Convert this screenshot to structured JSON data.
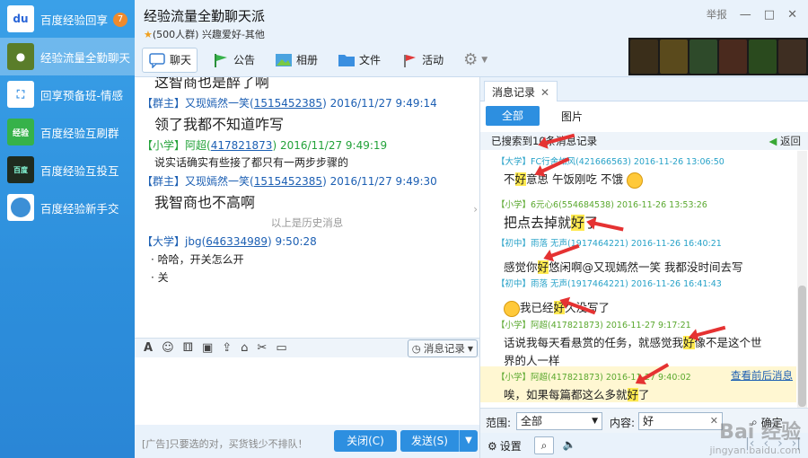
{
  "sidebar": {
    "items": [
      {
        "name": "百度经验回享",
        "badge": "7",
        "icon": "baidu-logo",
        "color": "#ffffff"
      },
      {
        "name": "经验流量全勤聊天",
        "icon": "group-avatar",
        "color": "#5a7d2a"
      },
      {
        "name": "回享预备班-情感",
        "icon": "gamepad-icon",
        "color": "#3b93e4"
      },
      {
        "name": "百度经验互刷群",
        "icon": "group-avatar",
        "color": "#36b24a"
      },
      {
        "name": "百度经验互投互",
        "icon": "group-avatar",
        "color": "#1f2b1f"
      },
      {
        "name": "百度经验新手交",
        "icon": "group-avatar",
        "color": "#3c8fd6"
      }
    ]
  },
  "header": {
    "title": "经验流量全勤聊天派",
    "subtitle": "(500人群) 兴趣爱好-其他",
    "report": "举报",
    "tabs": [
      {
        "label": "聊天",
        "icon": "chat-icon"
      },
      {
        "label": "公告",
        "icon": "flag-icon"
      },
      {
        "label": "相册",
        "icon": "photo-icon"
      },
      {
        "label": "文件",
        "icon": "folder-icon"
      },
      {
        "label": "活动",
        "icon": "activity-flag-icon"
      }
    ]
  },
  "chat": {
    "top_fragment": "这智商也是醉了啊",
    "messages": [
      {
        "role": "【群主】",
        "sender": "又现嫣然一笑",
        "id": "1515452385",
        "time": "2016/11/27 9:49:14",
        "text": "领了我都不知道咋写"
      },
      {
        "role": "【小学】",
        "sender": "阿超",
        "id": "417821873",
        "time": "2016/11/27 9:49:19",
        "text": "说实话确实有些接了都只有一两步步骤的"
      },
      {
        "role": "【群主】",
        "sender": "又现嫣然一笑",
        "id": "1515452385",
        "time": "2016/11/27 9:49:30",
        "text": "我智商也不高啊"
      }
    ],
    "history_divider": "以上是历史消息",
    "latest": {
      "role": "【大学】",
      "sender": "jbg",
      "id": "646334989",
      "time": "9:50:28",
      "lines": [
        "哈哈，开关怎么开",
        "关"
      ]
    }
  },
  "input_toolbar": {
    "history_button": "消息记录"
  },
  "bottom": {
    "ad_text": "[广告]只要选的对，买货钱少不排队！",
    "close_label": "关闭(C)",
    "send_label": "发送(S)"
  },
  "records": {
    "tab_title": "消息记录",
    "filter_all": "全部",
    "filter_pic": "图片",
    "found_text": "已搜索到10条消息记录",
    "back_label": "返回",
    "items": [
      {
        "head": "【大学】FC行舍如风(421666563) 2016-11-26 13:06:50",
        "pre": "不",
        "hl": "好",
        "post": "意思   午饭刚吃   不饿"
      },
      {
        "head": "【小学】6元心6(554684538) 2016-11-26 13:53:26",
        "pre": "把点去掉就",
        "hl": "好",
        "post": "了"
      },
      {
        "head": "【初中】雨落 无声(1917464221) 2016-11-26 16:40:21",
        "pre": "感觉你",
        "hl": "好",
        "post": "悠闲啊@又现嫣然一笑  我都没时间去写"
      },
      {
        "head": "【初中】雨落 无声(1917464221) 2016-11-26 16:41:43",
        "pre": "我已经",
        "hl": "好",
        "post": "久没写了"
      },
      {
        "head": "【小学】阿超(417821873) 2016-11-27 9:17:21",
        "pre": "话说我每天看悬赏的任务，就感觉我",
        "hl": "好",
        "post": "像不是这个世",
        "line2": "界的人一样"
      },
      {
        "head": "【小学】阿超(417821873) 2016-11-27 9:40:02",
        "pre": "唉，如果每篇都这么多就",
        "hl": "好",
        "post": "了"
      }
    ],
    "view_context": "查看前后消息",
    "range_label": "范围:",
    "range_value": "全部",
    "content_label": "内容:",
    "content_value": "好",
    "confirm": "确定",
    "settings": "设置"
  },
  "watermark": {
    "text": "Bai 经验",
    "url": "jingyan.baidu.com"
  }
}
